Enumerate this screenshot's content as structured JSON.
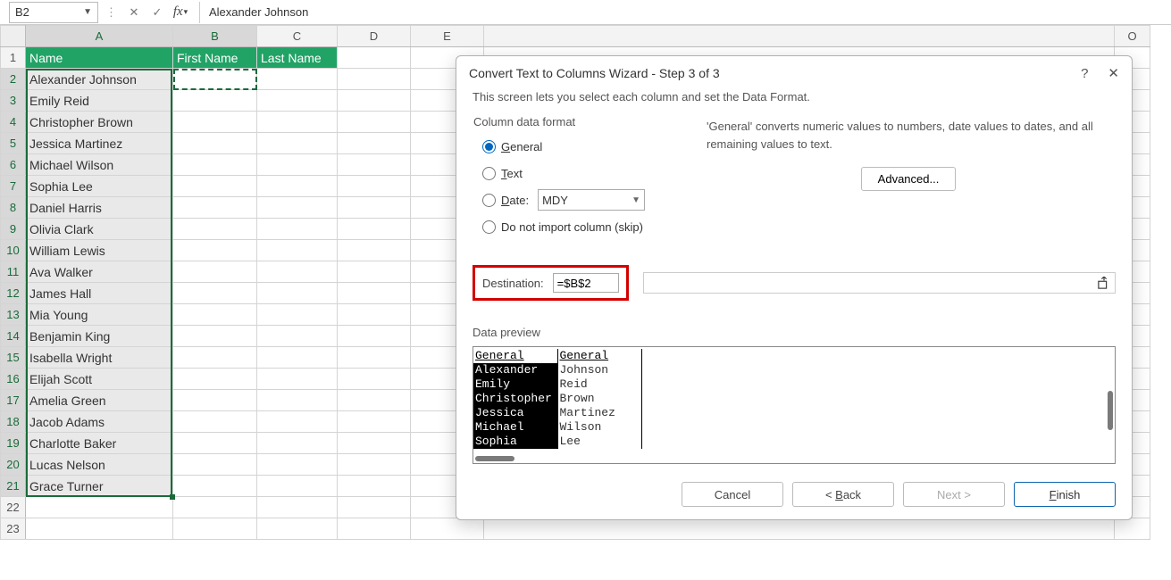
{
  "formula_bar": {
    "name_box": "B2",
    "cancel_icon": "✕",
    "accept_icon": "✓",
    "fx_label": "fx",
    "content": "Alexander Johnson"
  },
  "columns": {
    "A": "A",
    "B": "B",
    "C": "C",
    "D": "D",
    "E": "E",
    "O": "O"
  },
  "headers": {
    "A": "Name",
    "B": "First Name",
    "C": "Last Name"
  },
  "rows": [
    {
      "n": "1"
    },
    {
      "n": "2",
      "A": "Alexander Johnson"
    },
    {
      "n": "3",
      "A": "Emily Reid"
    },
    {
      "n": "4",
      "A": "Christopher Brown"
    },
    {
      "n": "5",
      "A": "Jessica Martinez"
    },
    {
      "n": "6",
      "A": "Michael Wilson"
    },
    {
      "n": "7",
      "A": "Sophia Lee"
    },
    {
      "n": "8",
      "A": "Daniel Harris"
    },
    {
      "n": "9",
      "A": "Olivia Clark"
    },
    {
      "n": "10",
      "A": "William Lewis"
    },
    {
      "n": "11",
      "A": "Ava Walker"
    },
    {
      "n": "12",
      "A": "James Hall"
    },
    {
      "n": "13",
      "A": "Mia Young"
    },
    {
      "n": "14",
      "A": "Benjamin King"
    },
    {
      "n": "15",
      "A": "Isabella Wright"
    },
    {
      "n": "16",
      "A": "Elijah Scott"
    },
    {
      "n": "17",
      "A": "Amelia Green"
    },
    {
      "n": "18",
      "A": "Jacob Adams"
    },
    {
      "n": "19",
      "A": "Charlotte Baker"
    },
    {
      "n": "20",
      "A": "Lucas Nelson"
    },
    {
      "n": "21",
      "A": "Grace Turner"
    },
    {
      "n": "22"
    },
    {
      "n": "23"
    }
  ],
  "dialog": {
    "title": "Convert Text to Columns Wizard - Step 3 of 3",
    "help_icon": "?",
    "close_icon": "✕",
    "description": "This screen lets you select each column and set the Data Format.",
    "format_section_title": "Column data format",
    "radios": {
      "general": "General",
      "text": "Text",
      "date": "Date:",
      "skip": "Do not import column (skip)"
    },
    "date_format": "MDY",
    "general_help": "'General' converts numeric values to numbers, date values to dates, and all remaining values to text.",
    "advanced_btn": "Advanced...",
    "destination_label": "Destination:",
    "destination_value": "=$B$2",
    "preview_title": "Data preview",
    "preview_header": {
      "c1": "General",
      "c2": "General"
    },
    "preview_rows": [
      {
        "c1": "Alexander",
        "c2": "Johnson"
      },
      {
        "c1": "Emily",
        "c2": "Reid"
      },
      {
        "c1": "Christopher",
        "c2": "Brown"
      },
      {
        "c1": "Jessica",
        "c2": "Martinez"
      },
      {
        "c1": "Michael",
        "c2": "Wilson"
      },
      {
        "c1": "Sophia",
        "c2": "Lee"
      }
    ],
    "buttons": {
      "cancel": "Cancel",
      "back": "Back",
      "next": "Next >",
      "finish": "Finish"
    }
  }
}
